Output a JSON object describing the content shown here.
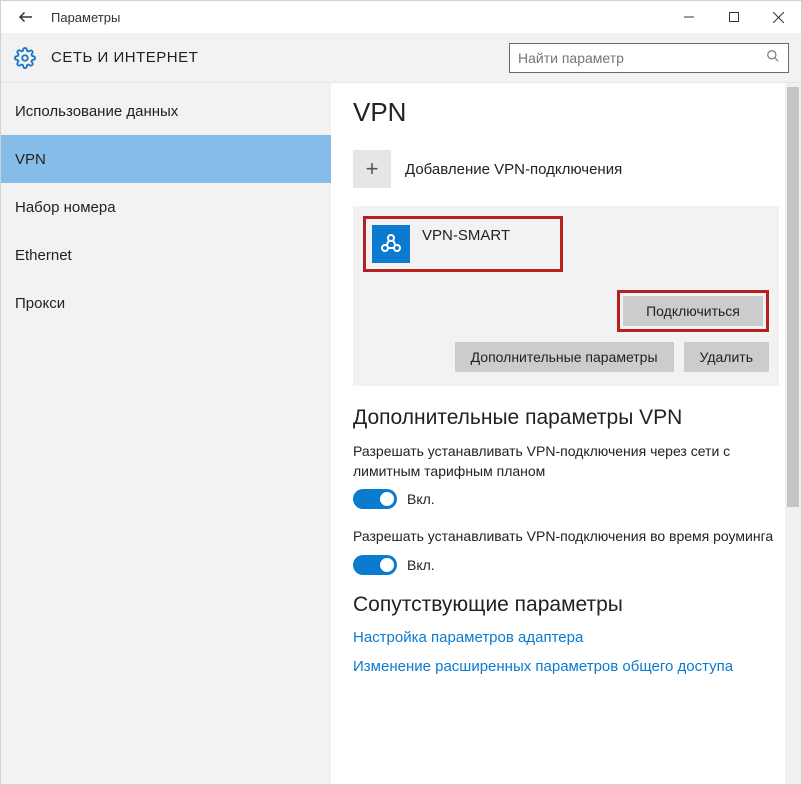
{
  "titlebar": {
    "title": "Параметры"
  },
  "header": {
    "section": "СЕТЬ И ИНТЕРНЕТ",
    "search_placeholder": "Найти параметр"
  },
  "sidebar": {
    "items": [
      {
        "label": "Использование данных",
        "active": false
      },
      {
        "label": "VPN",
        "active": true
      },
      {
        "label": "Набор номера",
        "active": false
      },
      {
        "label": "Ethernet",
        "active": false
      },
      {
        "label": "Прокси",
        "active": false
      }
    ]
  },
  "main": {
    "page_title": "VPN",
    "add_label": "Добавление VPN-подключения",
    "vpn_entry": {
      "name": "VPN-SMART"
    },
    "connect_label": "Подключиться",
    "advanced_label": "Дополнительные параметры",
    "delete_label": "Удалить",
    "extra_heading": "Дополнительные параметры VPN",
    "setting1": {
      "desc": "Разрешать устанавливать VPN-подключения через сети с лимитным тарифным планом",
      "state": "Вкл."
    },
    "setting2": {
      "desc": "Разрешать устанавливать VPN-подключения во время роуминга",
      "state": "Вкл."
    },
    "related_heading": "Сопутствующие параметры",
    "link1": "Настройка параметров адаптера",
    "link2": "Изменение расширенных параметров общего доступа"
  }
}
